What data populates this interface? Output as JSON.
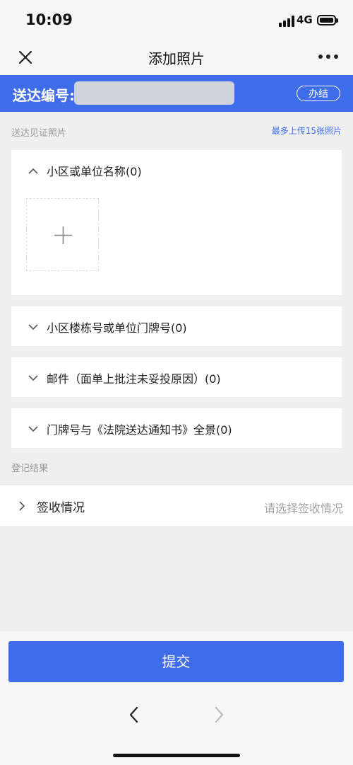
{
  "status_bar": {
    "time": "10:09",
    "network": "4G"
  },
  "nav": {
    "title": "添加照片"
  },
  "header": {
    "delivery_label": "送达编号:",
    "done_button": "办结"
  },
  "photos": {
    "section_label": "送达见证照片",
    "upload_limit": "最多上传15张照片",
    "groups": [
      {
        "title": "小区或单位名称(0)",
        "expanded": true
      },
      {
        "title": "小区楼栋号或单位门牌号(0)",
        "expanded": false
      },
      {
        "title": "邮件（面单上批注未妥投原因）(0)",
        "expanded": false
      },
      {
        "title": "门牌号与《法院送达通知书》全景(0)",
        "expanded": false
      }
    ]
  },
  "register": {
    "section_label": "登记结果",
    "receipt_label": "签收情况",
    "receipt_placeholder": "请选择签收情况"
  },
  "footer": {
    "submit_label": "提交"
  },
  "colors": {
    "accent": "#3f6ce8",
    "background": "#efefef"
  },
  "icons": [
    "close-icon",
    "more-icon",
    "chevron-up-icon",
    "chevron-down-icon",
    "chevron-right-icon",
    "plus-icon",
    "back-icon",
    "forward-icon"
  ]
}
